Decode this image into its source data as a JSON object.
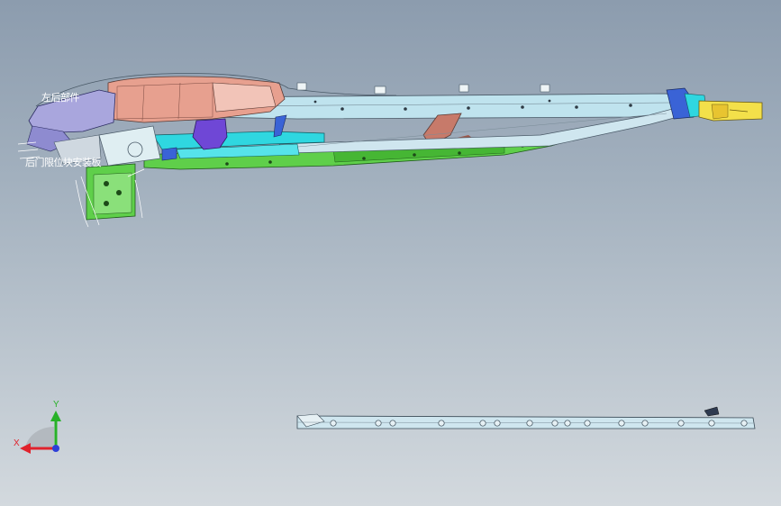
{
  "viewport": {
    "background_top": "#8c9cae",
    "background_bottom": "#d3d9de"
  },
  "model": {
    "labels": {
      "top": "左后部件",
      "side": "后门限位块安装板"
    },
    "part_colors": {
      "rail_light": "#bfe3ee",
      "rail_green": "#5fcf4a",
      "salmon": "#e7a08f",
      "lavender": "#a9a6dd",
      "cyan": "#2fd7e0",
      "yellow": "#f3e04a",
      "blue_bracket": "#3a63d6",
      "purple_bracket": "#6f47d6",
      "brown": "#c77a6a",
      "lower_rail": "#cfe6ef"
    }
  },
  "triad": {
    "x_label": "X",
    "y_label": "Y",
    "x_color": "#e0222c",
    "y_color": "#28b128",
    "z_color": "#2d3fd8"
  }
}
